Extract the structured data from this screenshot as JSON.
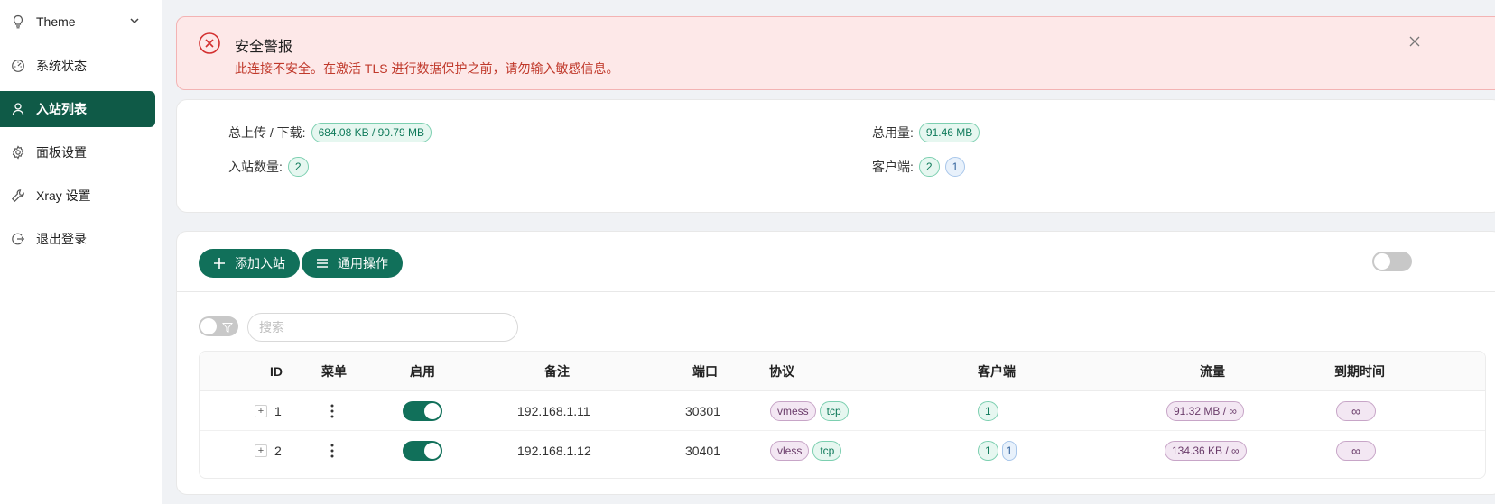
{
  "sidebar": {
    "items": [
      {
        "label": "Theme",
        "icon": "bulb-icon"
      },
      {
        "label": "系统状态",
        "icon": "dashboard-icon"
      },
      {
        "label": "入站列表",
        "icon": "user-icon"
      },
      {
        "label": "面板设置",
        "icon": "gear-icon"
      },
      {
        "label": "Xray 设置",
        "icon": "tool-icon"
      },
      {
        "label": "退出登录",
        "icon": "logout-icon"
      }
    ],
    "active": "入站列表"
  },
  "alert": {
    "title": "安全警报",
    "message": "此连接不安全。在激活 TLS 进行数据保护之前，请勿输入敏感信息。"
  },
  "stats": {
    "total_updown_label": "总上传 / 下载:",
    "total_updown_value": "684.08 KB / 90.79 MB",
    "total_usage_label": "总用量:",
    "total_usage_value": "91.46 MB",
    "inbound_count_label": "入站数量:",
    "inbound_count_value": "2",
    "clients_label": "客户端:",
    "clients_value": "2",
    "clients_value_2": "1"
  },
  "toolbar": {
    "add_label": "添加入站",
    "general_label": "通用操作"
  },
  "search": {
    "placeholder": "搜索"
  },
  "table": {
    "headers": {
      "id": "ID",
      "menu": "菜单",
      "enable": "启用",
      "remark": "备注",
      "port": "端口",
      "protocol": "协议",
      "clients": "客户端",
      "traffic": "流量",
      "expiry": "到期时间"
    },
    "rows": [
      {
        "id": "1",
        "enabled": true,
        "remark": "192.168.1.11",
        "port": "30301",
        "protocol": "vmess",
        "network": "tcp",
        "clients": "1",
        "clients_extra": "",
        "traffic": "91.32 MB / ∞",
        "expiry": "∞"
      },
      {
        "id": "2",
        "enabled": true,
        "remark": "192.168.1.12",
        "port": "30401",
        "protocol": "vless",
        "network": "tcp",
        "clients": "1",
        "clients_extra": "1",
        "traffic": "134.36 KB / ∞",
        "expiry": "∞"
      }
    ]
  },
  "colors": {
    "primary": "#11705a",
    "active_bg": "#0f5a47",
    "alert_bg": "#fde8e8",
    "alert_text": "#c0392b"
  }
}
